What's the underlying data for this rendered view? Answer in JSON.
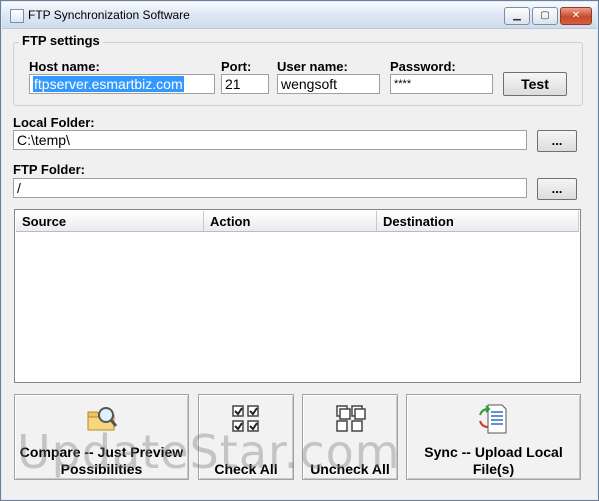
{
  "window": {
    "title": "FTP Synchronization Software",
    "minimize": "▁",
    "maximize": "▢",
    "close": "✕"
  },
  "ftp_settings": {
    "group_title": "FTP settings",
    "host_label": "Host name:",
    "host_value": "ftpserver.esmartbiz.com",
    "port_label": "Port:",
    "port_value": "21",
    "user_label": "User name:",
    "user_value": "wengsoft",
    "password_label": "Password:",
    "password_value": "****",
    "test_button": "Test"
  },
  "local_folder": {
    "label": "Local Folder:",
    "value": "C:\\temp\\",
    "browse": "..."
  },
  "ftp_folder": {
    "label": "FTP Folder:",
    "value": "/",
    "browse": "..."
  },
  "list": {
    "columns": [
      "Source",
      "Action",
      "Destination"
    ]
  },
  "actions": {
    "compare": "Compare -- Just Preview Possibilities",
    "check_all": "Check All",
    "uncheck_all": "Uncheck All",
    "sync": "Sync -- Upload Local File(s)"
  },
  "icons": {
    "compare": "folder-magnifier-icon",
    "check_all": "checked-boxes-icon",
    "uncheck_all": "unchecked-boxes-icon",
    "sync": "document-sync-icon"
  },
  "watermark": "UpdateStar.com"
}
